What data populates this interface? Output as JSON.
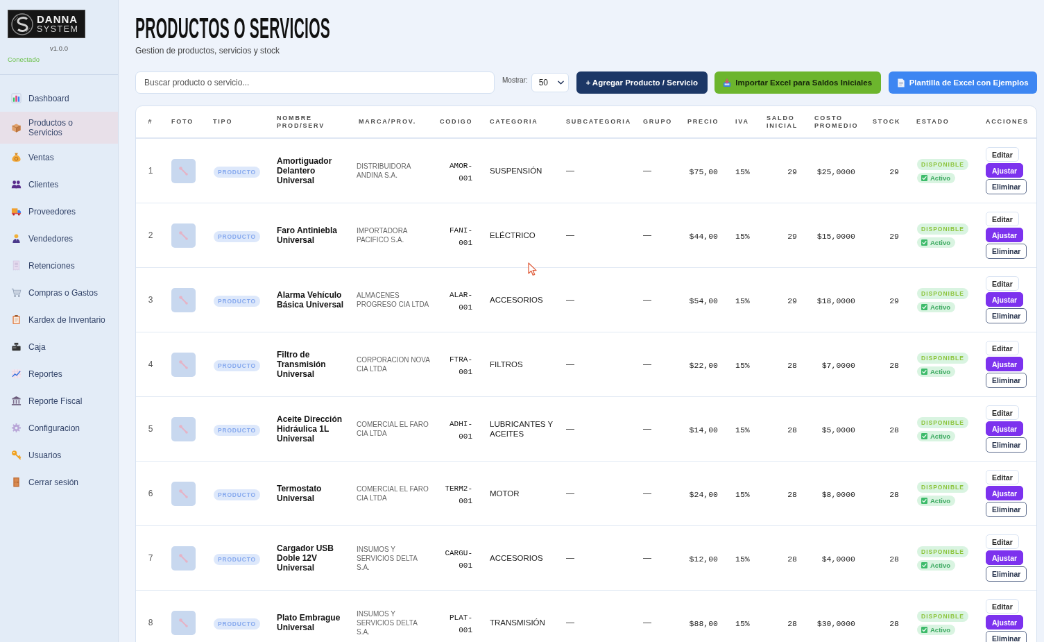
{
  "sidebar": {
    "logo": {
      "line_1": "DANNA",
      "line_2": "SYSTEM"
    },
    "version": "v1.0.0",
    "connection_status": "Conectado",
    "items": [
      {
        "label": "Dashboard",
        "selected": false
      },
      {
        "label": "Productos o Servicios",
        "selected": true
      },
      {
        "label": "Ventas",
        "selected": false
      },
      {
        "label": "Clientes",
        "selected": false
      },
      {
        "label": "Proveedores",
        "selected": false
      },
      {
        "label": "Vendedores",
        "selected": false
      },
      {
        "label": "Retenciones",
        "selected": false
      },
      {
        "label": "Compras o Gastos",
        "selected": false
      },
      {
        "label": "Kardex de Inventario",
        "selected": false
      },
      {
        "label": "Caja",
        "selected": false
      },
      {
        "label": "Reportes",
        "selected": false
      },
      {
        "label": "Reporte Fiscal",
        "selected": false
      },
      {
        "label": "Configuracion",
        "selected": false
      },
      {
        "label": "Usuarios",
        "selected": false
      },
      {
        "label": "Cerrar sesión",
        "selected": false
      }
    ]
  },
  "header": {
    "title": "PRODUCTOS O SERVICIOS",
    "subtitle": "Gestion de productos, servicios y stock"
  },
  "toolbar": {
    "search": {
      "placeholder": "Buscar producto o servicio..."
    },
    "page_size": {
      "label": "Mostrar:",
      "value": "50"
    },
    "buttons": [
      {
        "label": "+ Agregar Producto / Servicio",
        "kind": "primary"
      },
      {
        "label": "Importar Excel para Saldos Iniciales",
        "kind": "import"
      },
      {
        "label": "Plantilla de Excel con Ejemplos",
        "kind": "template"
      }
    ]
  },
  "table": {
    "columns": [
      "#",
      "FOTO",
      "TIPO",
      "NOMBRE PROD/SERV",
      "MARCA/PROV.",
      "CODIGO",
      "CATEGORIA",
      "SUBCATEGORIA",
      "GRUPO",
      "PRECIO",
      "IVA",
      "SALDO INICIAL",
      "COSTO PROMEDIO",
      "STOCK",
      "ESTADO",
      "ACCIONES"
    ],
    "rows": [
      {
        "number": "1",
        "type": "PRODUCTO",
        "name": "Amortiguador Delantero Universal",
        "brand": "DISTRIBUIDORA ANDINA S.A.",
        "code": "AMOR-001",
        "category": "SUSPENSIÓN",
        "subcategory": "—",
        "group": "—",
        "price": "$75,00",
        "vat": "15%",
        "opening_balance": "29",
        "average_cost": "$25,0000",
        "stock": "29",
        "status": "DISPONIBLE",
        "active_label": "Activo",
        "actions": [
          {
            "label": "Editar",
            "kind": "edit"
          },
          {
            "label": "Ajustar",
            "kind": "adjust"
          },
          {
            "label": "Eliminar",
            "kind": "delete"
          }
        ]
      },
      {
        "number": "2",
        "type": "PRODUCTO",
        "name": "Faro Antiniebla Universal",
        "brand": "IMPORTADORA PACIFICO S.A.",
        "code": "FANI-001",
        "category": "ELÉCTRICO",
        "subcategory": "—",
        "group": "—",
        "price": "$44,00",
        "vat": "15%",
        "opening_balance": "29",
        "average_cost": "$15,0000",
        "stock": "29",
        "status": "DISPONIBLE",
        "active_label": "Activo",
        "actions": [
          {
            "label": "Editar",
            "kind": "edit"
          },
          {
            "label": "Ajustar",
            "kind": "adjust"
          },
          {
            "label": "Eliminar",
            "kind": "delete"
          }
        ]
      },
      {
        "number": "3",
        "type": "PRODUCTO",
        "name": "Alarma Vehículo Básica Universal",
        "brand": "ALMACENES PROGRESO CIA LTDA",
        "code": "ALAR-001",
        "category": "ACCESORIOS",
        "subcategory": "—",
        "group": "—",
        "price": "$54,00",
        "vat": "15%",
        "opening_balance": "29",
        "average_cost": "$18,0000",
        "stock": "29",
        "status": "DISPONIBLE",
        "active_label": "Activo",
        "actions": [
          {
            "label": "Editar",
            "kind": "edit"
          },
          {
            "label": "Ajustar",
            "kind": "adjust"
          },
          {
            "label": "Eliminar",
            "kind": "delete"
          }
        ]
      },
      {
        "number": "4",
        "type": "PRODUCTO",
        "name": "Filtro de Transmisión Universal",
        "brand": "CORPORACION NOVA CIA LTDA",
        "code": "FTRA-001",
        "category": "FILTROS",
        "subcategory": "—",
        "group": "—",
        "price": "$22,00",
        "vat": "15%",
        "opening_balance": "28",
        "average_cost": "$7,0000",
        "stock": "28",
        "status": "DISPONIBLE",
        "active_label": "Activo",
        "actions": [
          {
            "label": "Editar",
            "kind": "edit"
          },
          {
            "label": "Ajustar",
            "kind": "adjust"
          },
          {
            "label": "Eliminar",
            "kind": "delete"
          }
        ]
      },
      {
        "number": "5",
        "type": "PRODUCTO",
        "name": "Aceite Dirección Hidráulica 1L Universal",
        "brand": "COMERCIAL EL FARO CIA LTDA",
        "code": "ADHI-001",
        "category": "LUBRICANTES Y ACEITES",
        "subcategory": "—",
        "group": "—",
        "price": "$14,00",
        "vat": "15%",
        "opening_balance": "28",
        "average_cost": "$5,0000",
        "stock": "28",
        "status": "DISPONIBLE",
        "active_label": "Activo",
        "actions": [
          {
            "label": "Editar",
            "kind": "edit"
          },
          {
            "label": "Ajustar",
            "kind": "adjust"
          },
          {
            "label": "Eliminar",
            "kind": "delete"
          }
        ]
      },
      {
        "number": "6",
        "type": "PRODUCTO",
        "name": "Termostato Universal",
        "brand": "COMERCIAL EL FARO CIA LTDA",
        "code": "TERM2-001",
        "category": "MOTOR",
        "subcategory": "—",
        "group": "—",
        "price": "$24,00",
        "vat": "15%",
        "opening_balance": "28",
        "average_cost": "$8,0000",
        "stock": "28",
        "status": "DISPONIBLE",
        "active_label": "Activo",
        "actions": [
          {
            "label": "Editar",
            "kind": "edit"
          },
          {
            "label": "Ajustar",
            "kind": "adjust"
          },
          {
            "label": "Eliminar",
            "kind": "delete"
          }
        ]
      },
      {
        "number": "7",
        "type": "PRODUCTO",
        "name": "Cargador USB Doble 12V Universal",
        "brand": "INSUMOS Y SERVICIOS DELTA S.A.",
        "code": "CARGU-001",
        "category": "ACCESORIOS",
        "subcategory": "—",
        "group": "—",
        "price": "$12,00",
        "vat": "15%",
        "opening_balance": "28",
        "average_cost": "$4,0000",
        "stock": "28",
        "status": "DISPONIBLE",
        "active_label": "Activo",
        "actions": [
          {
            "label": "Editar",
            "kind": "edit"
          },
          {
            "label": "Ajustar",
            "kind": "adjust"
          },
          {
            "label": "Eliminar",
            "kind": "delete"
          }
        ]
      },
      {
        "number": "8",
        "type": "PRODUCTO",
        "name": "Plato Embrague Universal",
        "brand": "INSUMOS Y SERVICIOS DELTA S.A.",
        "code": "PLAT-001",
        "category": "TRANSMISIÓN",
        "subcategory": "—",
        "group": "—",
        "price": "$88,00",
        "vat": "15%",
        "opening_balance": "28",
        "average_cost": "$30,0000",
        "stock": "28",
        "status": "DISPONIBLE",
        "active_label": "Activo",
        "actions": [
          {
            "label": "Editar",
            "kind": "edit"
          },
          {
            "label": "Ajustar",
            "kind": "adjust"
          },
          {
            "label": "Eliminar",
            "kind": "delete"
          }
        ]
      }
    ]
  }
}
